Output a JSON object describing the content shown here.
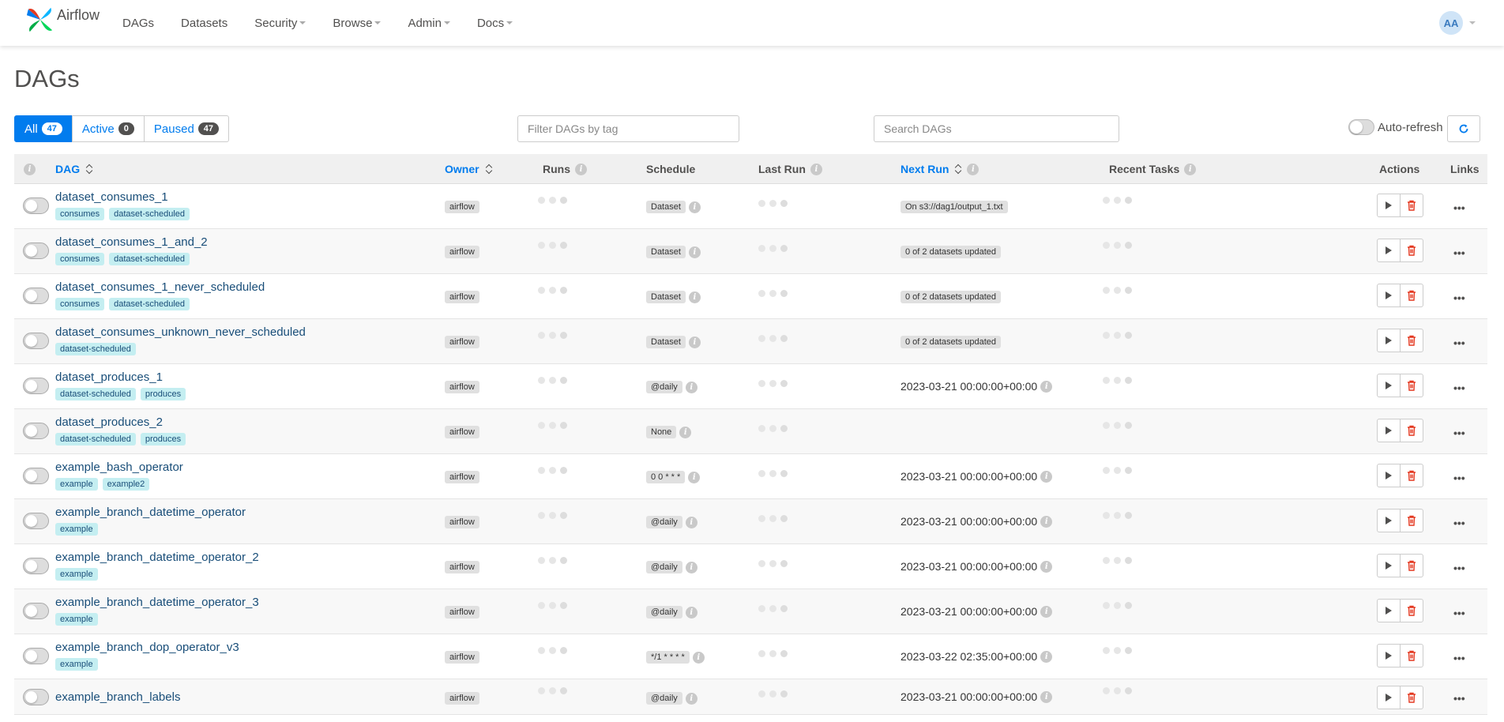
{
  "navbar": {
    "brand": "Airflow",
    "items": [
      {
        "label": "DAGs",
        "dropdown": false
      },
      {
        "label": "Datasets",
        "dropdown": false
      },
      {
        "label": "Security",
        "dropdown": true
      },
      {
        "label": "Browse",
        "dropdown": true
      },
      {
        "label": "Admin",
        "dropdown": true
      },
      {
        "label": "Docs",
        "dropdown": true
      }
    ],
    "user_initials": "AA"
  },
  "page_title": "DAGs",
  "status_filter": {
    "all": {
      "label": "All",
      "count": "47"
    },
    "active": {
      "label": "Active",
      "count": "0"
    },
    "paused": {
      "label": "Paused",
      "count": "47"
    }
  },
  "tag_filter_placeholder": "Filter DAGs by tag",
  "search_placeholder": "Search DAGs",
  "auto_refresh_label": "Auto-refresh",
  "columns": {
    "dag": "DAG",
    "owner": "Owner",
    "runs": "Runs",
    "schedule": "Schedule",
    "last_run": "Last Run",
    "next_run": "Next Run",
    "recent_tasks": "Recent Tasks",
    "actions": "Actions",
    "links": "Links"
  },
  "links_label": "•••",
  "info_glyph": "i",
  "colors": {
    "primary": "#017cee",
    "dag_link": "#194e79",
    "tag_bg": "#c4eef1",
    "delete": "#e43921"
  },
  "dags": [
    {
      "name": "dataset_consumes_1",
      "tags": [
        "consumes",
        "dataset-scheduled"
      ],
      "owner": "airflow",
      "schedule": "Dataset",
      "next_run": "On s3://dag1/output_1.txt",
      "next_run_type": "badge"
    },
    {
      "name": "dataset_consumes_1_and_2",
      "tags": [
        "consumes",
        "dataset-scheduled"
      ],
      "owner": "airflow",
      "schedule": "Dataset",
      "next_run": "0 of 2 datasets updated",
      "next_run_type": "badge"
    },
    {
      "name": "dataset_consumes_1_never_scheduled",
      "tags": [
        "consumes",
        "dataset-scheduled"
      ],
      "owner": "airflow",
      "schedule": "Dataset",
      "next_run": "0 of 2 datasets updated",
      "next_run_type": "badge"
    },
    {
      "name": "dataset_consumes_unknown_never_scheduled",
      "tags": [
        "dataset-scheduled"
      ],
      "owner": "airflow",
      "schedule": "Dataset",
      "next_run": "0 of 2 datasets updated",
      "next_run_type": "badge"
    },
    {
      "name": "dataset_produces_1",
      "tags": [
        "dataset-scheduled",
        "produces"
      ],
      "owner": "airflow",
      "schedule": "@daily",
      "next_run": "2023-03-21 00:00:00+00:00",
      "next_run_type": "text"
    },
    {
      "name": "dataset_produces_2",
      "tags": [
        "dataset-scheduled",
        "produces"
      ],
      "owner": "airflow",
      "schedule": "None",
      "next_run": "",
      "next_run_type": "none"
    },
    {
      "name": "example_bash_operator",
      "tags": [
        "example",
        "example2"
      ],
      "owner": "airflow",
      "schedule": "0 0 * * *",
      "next_run": "2023-03-21 00:00:00+00:00",
      "next_run_type": "text"
    },
    {
      "name": "example_branch_datetime_operator",
      "tags": [
        "example"
      ],
      "owner": "airflow",
      "schedule": "@daily",
      "next_run": "2023-03-21 00:00:00+00:00",
      "next_run_type": "text"
    },
    {
      "name": "example_branch_datetime_operator_2",
      "tags": [
        "example"
      ],
      "owner": "airflow",
      "schedule": "@daily",
      "next_run": "2023-03-21 00:00:00+00:00",
      "next_run_type": "text"
    },
    {
      "name": "example_branch_datetime_operator_3",
      "tags": [
        "example"
      ],
      "owner": "airflow",
      "schedule": "@daily",
      "next_run": "2023-03-21 00:00:00+00:00",
      "next_run_type": "text"
    },
    {
      "name": "example_branch_dop_operator_v3",
      "tags": [
        "example"
      ],
      "owner": "airflow",
      "schedule": "*/1 * * * *",
      "next_run": "2023-03-22 02:35:00+00:00",
      "next_run_type": "text"
    },
    {
      "name": "example_branch_labels",
      "tags": [],
      "owner": "airflow",
      "schedule": "@daily",
      "next_run": "2023-03-21 00:00:00+00:00",
      "next_run_type": "text"
    }
  ]
}
